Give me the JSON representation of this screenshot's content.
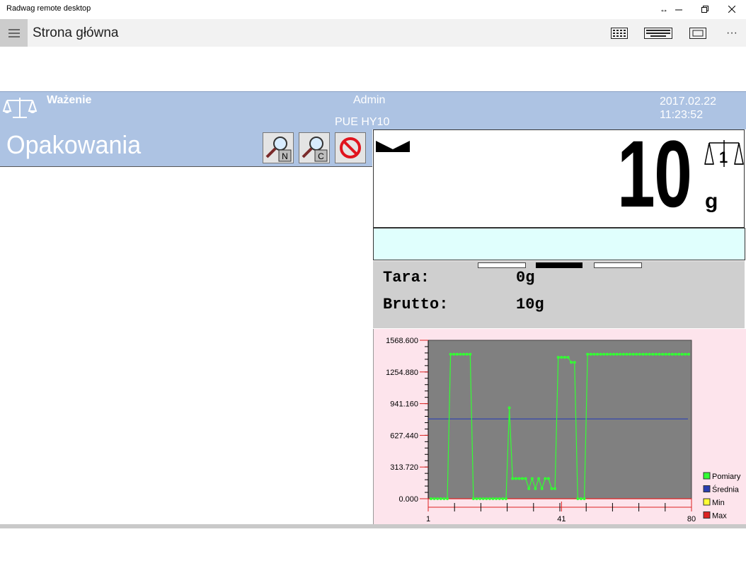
{
  "window": {
    "title": "Radwag remote desktop"
  },
  "appbar": {
    "title": "Strona główna"
  },
  "header": {
    "mode": "Ważenie",
    "user": "Admin",
    "model": "PUE HY10",
    "date": "2017.02.22",
    "time": "11:23:52"
  },
  "left": {
    "title": "Opakowania",
    "buttons": [
      {
        "icon": "search-n-icon",
        "label": "N"
      },
      {
        "icon": "search-c-icon",
        "label": "C"
      },
      {
        "icon": "cancel-icon"
      }
    ]
  },
  "weight": {
    "value": "10",
    "unit": "g",
    "platform": "1"
  },
  "info": {
    "tare_label": "Tara:",
    "tare_value": "0g",
    "gross_label": "Brutto:",
    "gross_value": "10g"
  },
  "chart_data": {
    "type": "line",
    "x": [
      1,
      41,
      80
    ],
    "xticks": [
      "1",
      "41",
      "80"
    ],
    "yticks": [
      "0.000",
      "313.720",
      "627.440",
      "941.160",
      "1254.880",
      "1568.600"
    ],
    "ylim": [
      0,
      1568.6
    ],
    "xlim": [
      1,
      80
    ],
    "legend": [
      "Pomiary",
      "Średnia",
      "Min",
      "Max"
    ],
    "legend_position": "right",
    "colors": {
      "measure": "#33ff33",
      "mean": "#2a3fb0",
      "min": "#ffff33",
      "max": "#dd2222",
      "plot_bg": "#808080"
    },
    "mean": 790,
    "series": [
      {
        "name": "Pomiary",
        "values": [
          0,
          0,
          0,
          0,
          0,
          0,
          1430,
          1430,
          1430,
          1430,
          1430,
          1430,
          1430,
          0,
          0,
          0,
          0,
          0,
          0,
          0,
          0,
          0,
          0,
          0,
          900,
          200,
          200,
          200,
          200,
          200,
          100,
          200,
          100,
          200,
          100,
          200,
          200,
          100,
          100,
          1400,
          1400,
          1400,
          1400,
          1350,
          1350,
          0,
          0,
          0,
          1430,
          1430,
          1430,
          1430,
          1430,
          1430,
          1430,
          1430,
          1430,
          1430,
          1430,
          1430,
          1430,
          1430,
          1430,
          1430,
          1430,
          1430,
          1430,
          1430,
          1430,
          1430,
          1430,
          1430,
          1430,
          1430,
          1430,
          1430,
          1430,
          1430,
          1430,
          1430
        ]
      }
    ]
  }
}
